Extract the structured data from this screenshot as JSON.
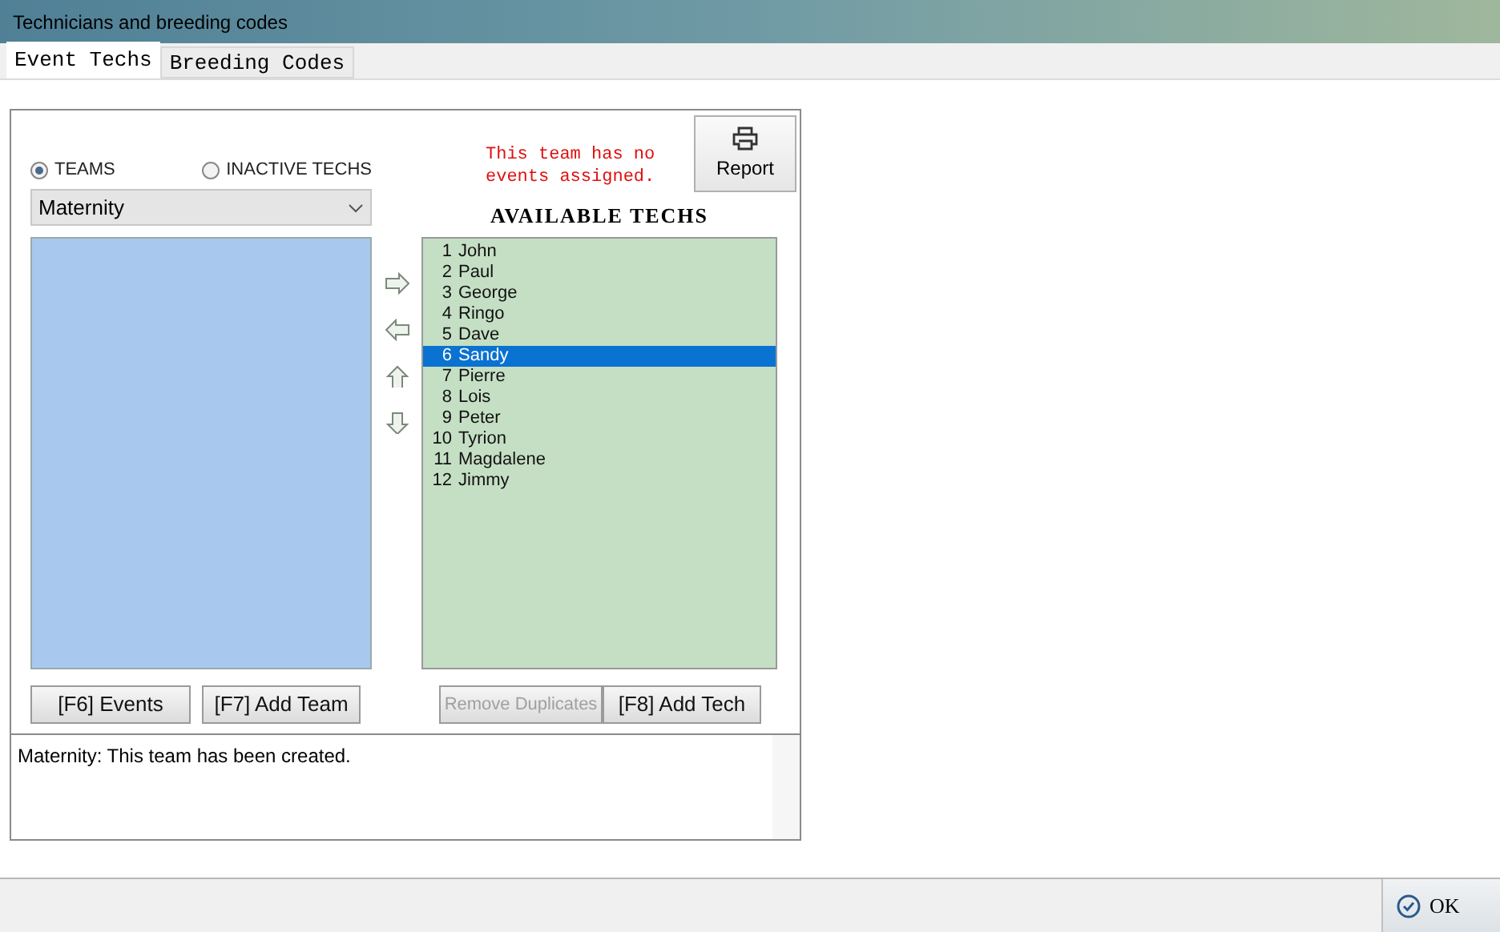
{
  "window": {
    "title": "Technicians and breeding codes"
  },
  "tabs": [
    {
      "label": "Event Techs",
      "selected": true
    },
    {
      "label": "Breeding Codes",
      "selected": false
    }
  ],
  "radios": [
    {
      "label": "TEAMS",
      "selected": true
    },
    {
      "label": "INACTIVE TECHS",
      "selected": false
    }
  ],
  "team_select": {
    "value": "Maternity"
  },
  "notice": "This team has no events assigned.",
  "report_button": "Report",
  "available_heading": "AVAILABLE TECHS",
  "techs": [
    {
      "number": "1",
      "name": "John",
      "selected": false
    },
    {
      "number": "2",
      "name": "Paul",
      "selected": false
    },
    {
      "number": "3",
      "name": "George",
      "selected": false
    },
    {
      "number": "4",
      "name": "Ringo",
      "selected": false
    },
    {
      "number": "5",
      "name": "Dave",
      "selected": false
    },
    {
      "number": "6",
      "name": "Sandy",
      "selected": true
    },
    {
      "number": "7",
      "name": "Pierre",
      "selected": false
    },
    {
      "number": "8",
      "name": "Lois",
      "selected": false
    },
    {
      "number": "9",
      "name": "Peter",
      "selected": false
    },
    {
      "number": "10",
      "name": "Tyrion",
      "selected": false
    },
    {
      "number": "11",
      "name": "Magdalene",
      "selected": false
    },
    {
      "number": "12",
      "name": "Jimmy",
      "selected": false
    }
  ],
  "left_buttons": [
    {
      "label": "[F6] Events",
      "disabled": false
    },
    {
      "label": "[F7] Add Team",
      "disabled": false
    }
  ],
  "right_buttons": [
    {
      "label": "Remove Duplicates",
      "disabled": true
    },
    {
      "label": "[F8] Add Tech",
      "disabled": false
    }
  ],
  "log": "Maternity: This team has been created.",
  "ok_button": "OK"
}
